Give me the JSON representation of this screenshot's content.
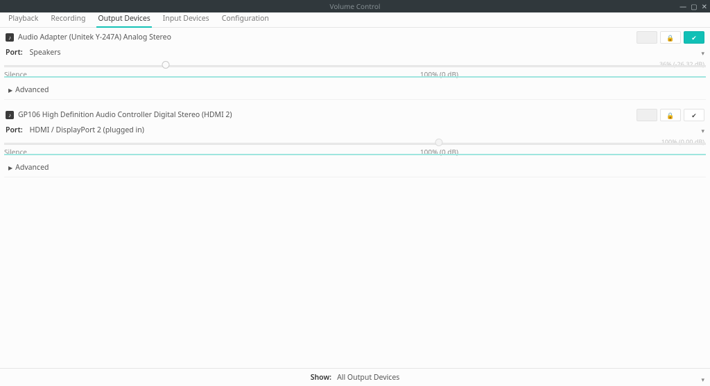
{
  "window": {
    "title": "Volume Control"
  },
  "tabs": [
    {
      "label": "Playback",
      "active": false
    },
    {
      "label": "Recording",
      "active": false
    },
    {
      "label": "Output Devices",
      "active": true
    },
    {
      "label": "Input Devices",
      "active": false
    },
    {
      "label": "Configuration",
      "active": false
    }
  ],
  "footer": {
    "show_label": "Show:",
    "show_value": "All Output Devices"
  },
  "labels": {
    "port": "Port:",
    "silence": "Silence",
    "hundred": "100% (0 dB)",
    "advanced": "Advanced"
  },
  "devices": [
    {
      "name": "Audio Adapter (Unitek Y-247A) Analog Stereo",
      "port": "Speakers",
      "right_scale": "36% (-26.32 dB)",
      "slider_pct": 23,
      "is_default": true,
      "slider_enabled": true
    },
    {
      "name": "GP106 High Definition Audio Controller Digital Stereo (HDMI 2)",
      "port": "HDMI / DisplayPort 2 (plugged in)",
      "right_scale": "100% (0.00 dB)",
      "slider_pct": 62,
      "is_default": false,
      "slider_enabled": false
    }
  ]
}
